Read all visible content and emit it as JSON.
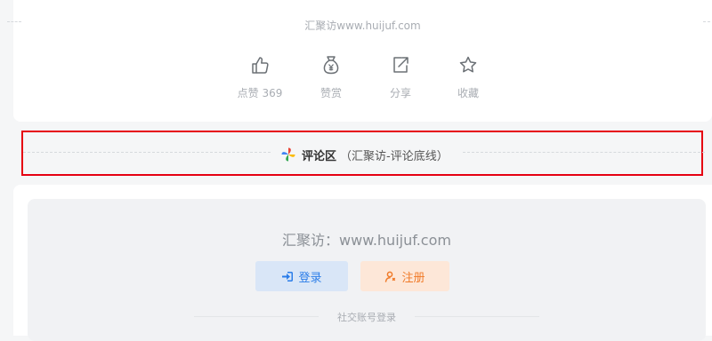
{
  "article_footer": {
    "site_line": "汇聚访www.huijuf.com",
    "actions": [
      {
        "icon": "thumbs-up-icon",
        "label": "点赞 369"
      },
      {
        "icon": "money-bag-icon",
        "label": "赞赏"
      },
      {
        "icon": "share-icon",
        "label": "分享"
      },
      {
        "icon": "star-icon",
        "label": "收藏"
      }
    ]
  },
  "comment_divider": {
    "icon": "pinwheel-icon",
    "title": "评论区",
    "subtitle": "（汇聚访-评论底线）",
    "highlight_color": "#e60012"
  },
  "comment_login": {
    "site_line": "汇聚访：www.huijuf.com",
    "login_label": "登录",
    "login_icon": "sign-in-icon",
    "register_label": "注册",
    "register_icon": "user-icon",
    "social_label": "社交账号登录"
  }
}
